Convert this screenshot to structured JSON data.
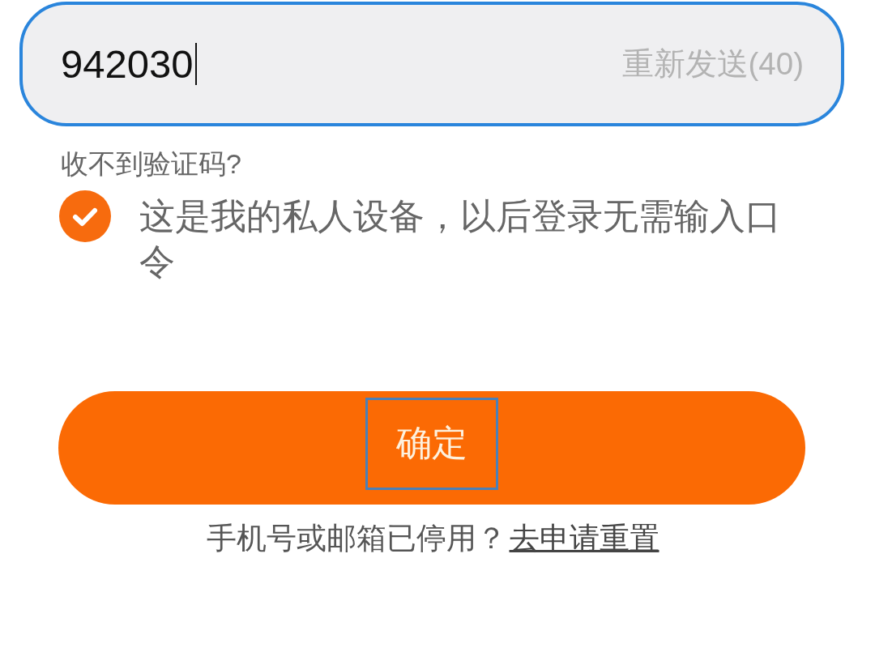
{
  "code_field": {
    "value": "942030",
    "focused": true,
    "resend_button": "重新发送(40)"
  },
  "help_link": "收不到验证码?",
  "trust_device": {
    "label": "这是我的私人设备，以后登录无需输入口令",
    "checked": true
  },
  "confirm_button": {
    "label": "确定",
    "focused": true
  },
  "footer": {
    "text": "手机号或邮箱已停用？",
    "link": "去申请重置"
  }
}
